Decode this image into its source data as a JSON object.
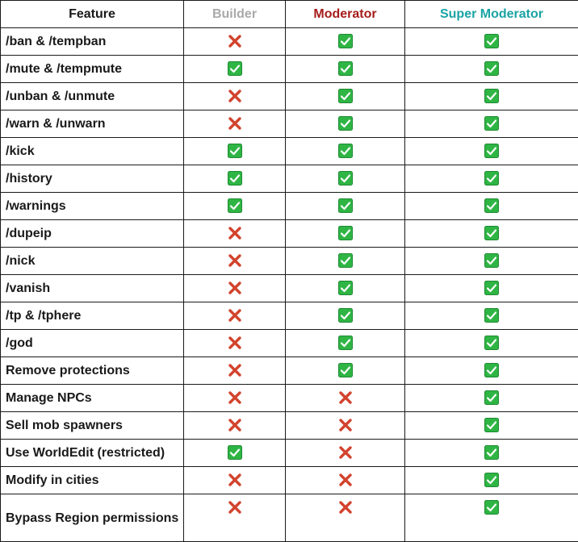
{
  "colors": {
    "builder": "#a9a9a9",
    "moderator": "#a61c1c",
    "super_moderator": "#1aa3a3",
    "check_bg": "#2fb544",
    "cross": "#d2432d",
    "border": "#1a1a1a"
  },
  "headers": {
    "feature": "Feature",
    "builder": "Builder",
    "moderator": "Moderator",
    "super_moderator": "Super Moderator"
  },
  "rows": [
    {
      "feature": "/ban & /tempban",
      "builder": "cross-icon",
      "moderator": "check-icon",
      "super_moderator": "check-icon"
    },
    {
      "feature": "/mute & /tempmute",
      "builder": "check-icon",
      "moderator": "check-icon",
      "super_moderator": "check-icon"
    },
    {
      "feature": "/unban & /unmute",
      "builder": "cross-icon",
      "moderator": "check-icon",
      "super_moderator": "check-icon"
    },
    {
      "feature": "/warn & /unwarn",
      "builder": "cross-icon",
      "moderator": "check-icon",
      "super_moderator": "check-icon"
    },
    {
      "feature": "/kick",
      "builder": "check-icon",
      "moderator": "check-icon",
      "super_moderator": "check-icon"
    },
    {
      "feature": "/history",
      "builder": "check-icon",
      "moderator": "check-icon",
      "super_moderator": "check-icon"
    },
    {
      "feature": "/warnings",
      "builder": "check-icon",
      "moderator": "check-icon",
      "super_moderator": "check-icon"
    },
    {
      "feature": "/dupeip",
      "builder": "cross-icon",
      "moderator": "check-icon",
      "super_moderator": "check-icon"
    },
    {
      "feature": "/nick",
      "builder": "cross-icon",
      "moderator": "check-icon",
      "super_moderator": "check-icon"
    },
    {
      "feature": "/vanish",
      "builder": "cross-icon",
      "moderator": "check-icon",
      "super_moderator": "check-icon"
    },
    {
      "feature": "/tp & /tphere",
      "builder": "cross-icon",
      "moderator": "check-icon",
      "super_moderator": "check-icon"
    },
    {
      "feature": "/god",
      "builder": "cross-icon",
      "moderator": "check-icon",
      "super_moderator": "check-icon"
    },
    {
      "feature": "Remove protections",
      "builder": "cross-icon",
      "moderator": "check-icon",
      "super_moderator": "check-icon"
    },
    {
      "feature": "Manage NPCs",
      "builder": "cross-icon",
      "moderator": "cross-icon",
      "super_moderator": "check-icon"
    },
    {
      "feature": "Sell mob spawners",
      "builder": "cross-icon",
      "moderator": "cross-icon",
      "super_moderator": "check-icon"
    },
    {
      "feature": "Use WorldEdit (restricted)",
      "builder": "check-icon",
      "moderator": "cross-icon",
      "super_moderator": "check-icon"
    },
    {
      "feature": "Modify in cities",
      "builder": "cross-icon",
      "moderator": "cross-icon",
      "super_moderator": "check-icon"
    },
    {
      "feature": "Bypass Region permissions",
      "builder": "cross-icon",
      "moderator": "cross-icon",
      "super_moderator": "check-icon"
    }
  ]
}
